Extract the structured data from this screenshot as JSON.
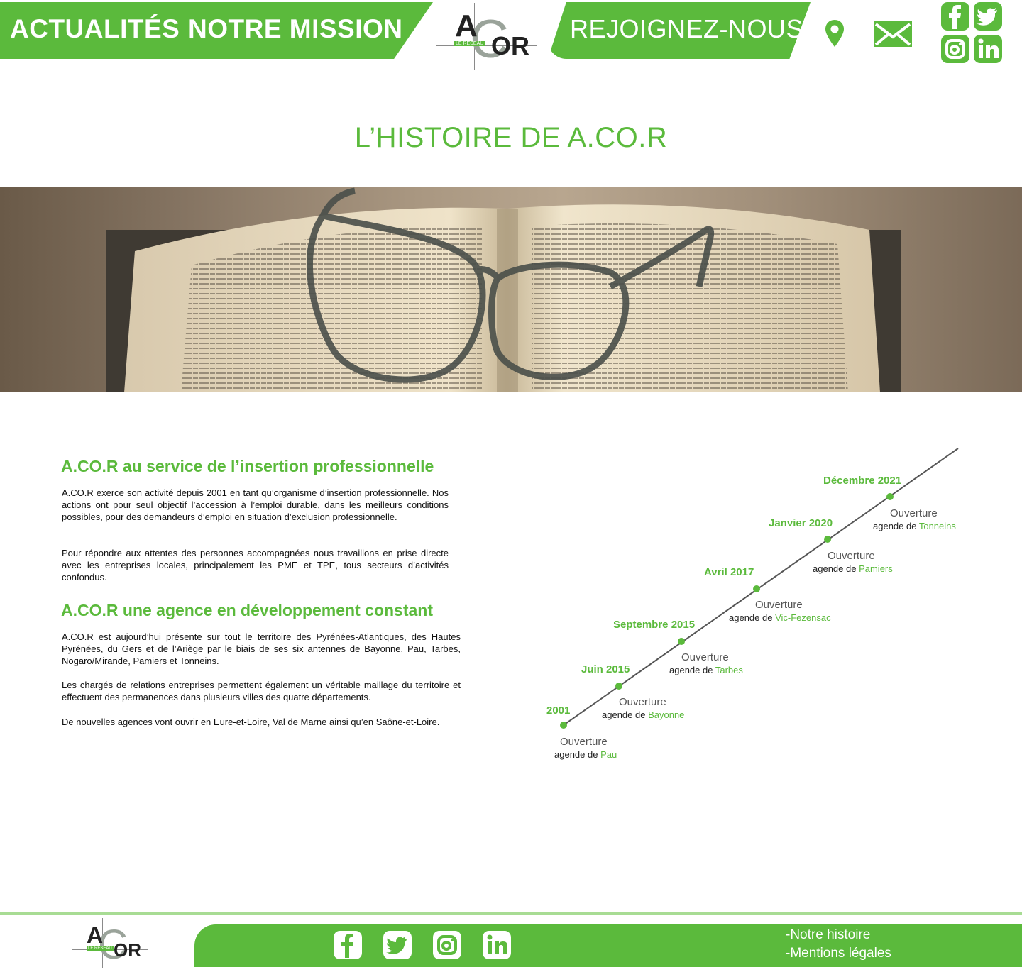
{
  "nav": {
    "news_label": "ACTUALITÉS",
    "mission_label": "NOTRE MISSION",
    "join_label": "REJOIGNEZ-NOUS"
  },
  "logo": {
    "a": "A",
    "c": "C",
    "or": "OR",
    "tagline": "LE RESEAU"
  },
  "page": {
    "title": "L’HISTOIRE DE A.CO.R"
  },
  "sections": [
    {
      "title": "A.CO.R au service de l’insertion professionnelle",
      "paragraphs": [
        "A.CO.R exerce son activité depuis 2001 en tant qu’organisme d’insertion professionnelle. Nos actions ont pour seul objectif l’accession à l’emploi durable, dans les meilleurs conditions possibles, pour des demandeurs d’emploi en situation d’exclusion professionnelle.",
        "Pour répondre aux attentes des personnes accompagnées nous travaillons en prise directe avec les entreprises locales, principalement les PME et TPE, tous secteurs d’activités confondus."
      ]
    },
    {
      "title": "A.CO.R une agence en développement constant",
      "paragraphs": [
        "A.CO.R est aujourd’hui présente sur tout le territoire des Pyrénées-Atlantiques, des Hautes Pyrénées, du Gers et de l’Ariège par le biais de ses six antennes de Bayonne, Pau, Tarbes, Nogaro/Mirande, Pamiers et Tonneins.",
        "Les chargés de relations entreprises permettent également un véritable maillage du territoire et effectuent des permanences dans plusieurs villes des quatre départements.",
        "De nouvelles agences vont ouvrir en Eure-et-Loire, Val de Marne ainsi qu’en Saône-et-Loire."
      ]
    }
  ],
  "timeline": {
    "open_label": "Ouverture",
    "agency_prefix": "agende de",
    "events": [
      {
        "date": "2001",
        "city": "Pau"
      },
      {
        "date": "Juin 2015",
        "city": "Bayonne"
      },
      {
        "date": "Septembre 2015",
        "city": "Tarbes"
      },
      {
        "date": "Avril 2017",
        "city": "Vic-Fezensac"
      },
      {
        "date": "Janvier 2020",
        "city": "Pamiers"
      },
      {
        "date": "Décembre 2021",
        "city": "Tonneins"
      }
    ]
  },
  "footer": {
    "links": [
      "-Notre histoire",
      "-Mentions légales"
    ]
  },
  "colors": {
    "brand_green": "#5bba3c",
    "footer_line": "#a8dc94"
  },
  "icons": [
    "map-pin-icon",
    "mail-icon",
    "facebook-icon",
    "twitter-icon",
    "instagram-icon",
    "linkedin-icon"
  ]
}
